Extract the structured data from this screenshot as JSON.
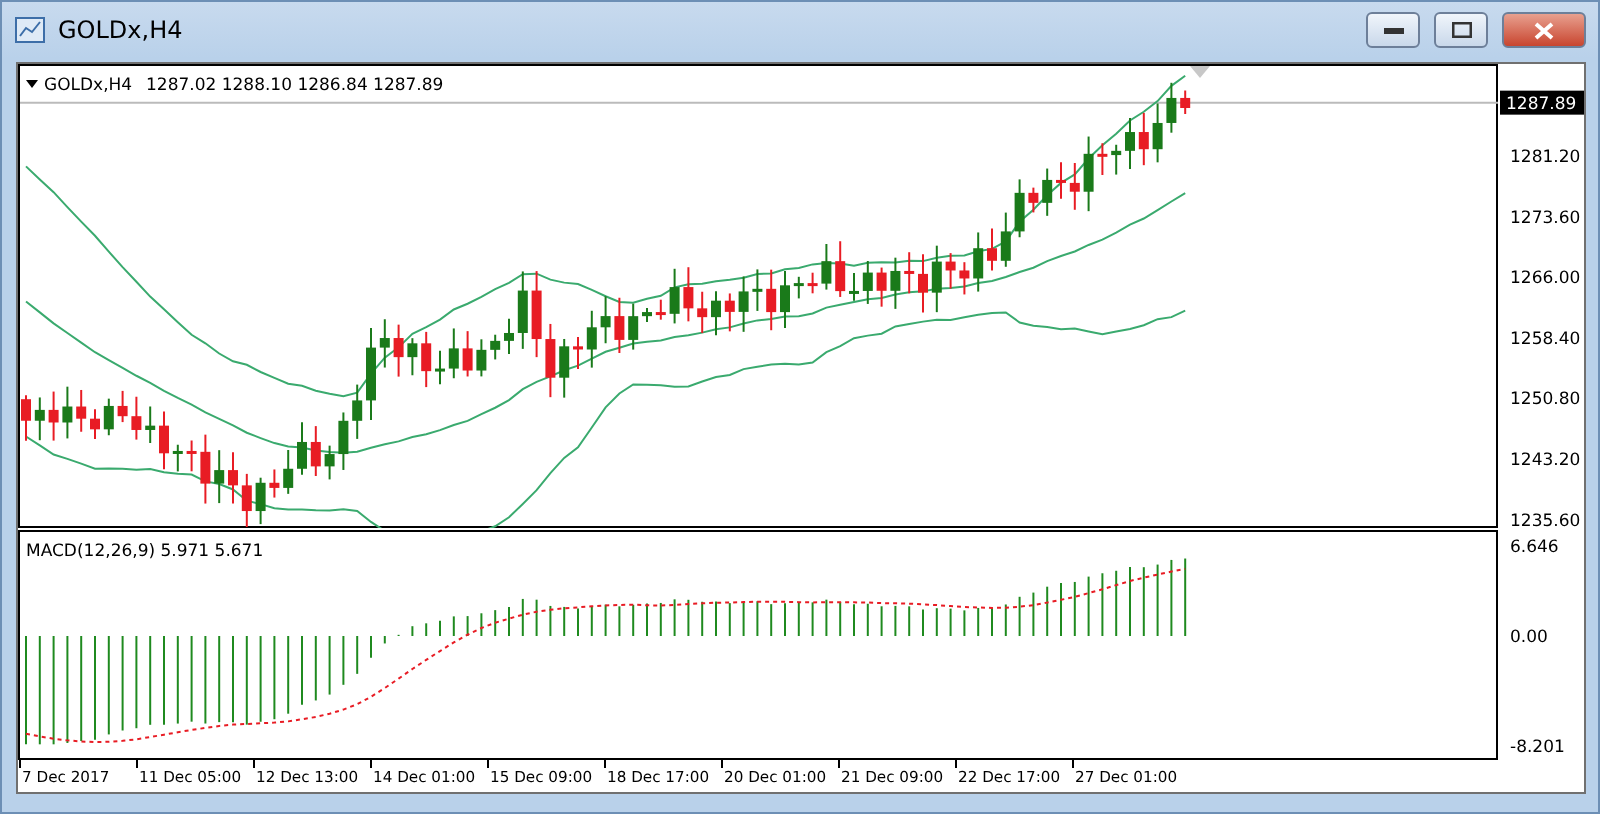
{
  "window": {
    "title": "GOLDx,H4"
  },
  "chart": {
    "symbol": "GOLDx,H4",
    "ohlc": "1287.02 1288.10 1286.84 1287.89",
    "current_price": "1287.89",
    "price_axis": [
      "1281.20",
      "1273.60",
      "1266.00",
      "1258.40",
      "1250.80",
      "1243.20",
      "1235.60"
    ]
  },
  "macd": {
    "label": "MACD(12,26,9) 5.971 5.671",
    "axis": [
      "6.646",
      "0.00",
      "-8.201"
    ]
  },
  "time_axis": [
    "7 Dec 2017",
    "11 Dec 05:00",
    "12 Dec 13:00",
    "14 Dec 01:00",
    "15 Dec 09:00",
    "18 Dec 17:00",
    "20 Dec 01:00",
    "21 Dec 09:00",
    "22 Dec 17:00",
    "27 Dec 01:00"
  ]
}
